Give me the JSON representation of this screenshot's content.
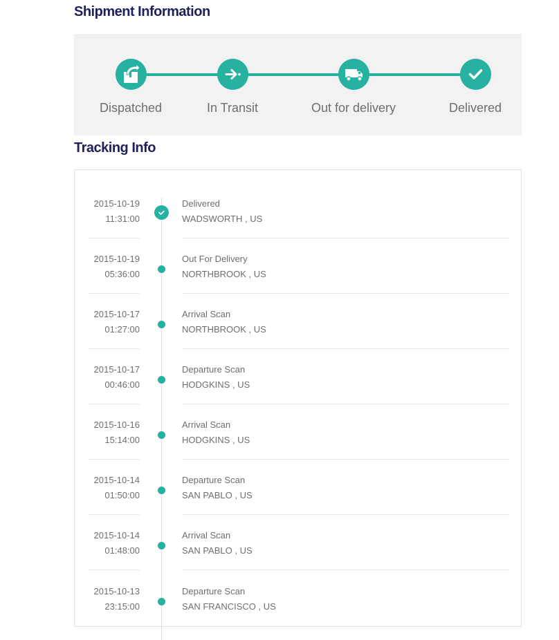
{
  "shipment": {
    "title": "Shipment Information",
    "steps": [
      {
        "label": "Dispatched",
        "icon": "dispatched-box-icon"
      },
      {
        "label": "In Transit",
        "icon": "arrow-transit-icon"
      },
      {
        "label": "Out for delivery",
        "icon": "truck-icon"
      },
      {
        "label": "Delivered",
        "icon": "checkmark-icon"
      }
    ],
    "accent_color": "#26b1a0",
    "title_color": "#1e1f5b"
  },
  "tracking": {
    "title": "Tracking Info",
    "events": [
      {
        "date": "2015-10-19",
        "time": "11:31:00",
        "status": "Delivered",
        "location": "WADSWORTH , US"
      },
      {
        "date": "2015-10-19",
        "time": "05:36:00",
        "status": "Out For Delivery",
        "location": "NORTHBROOK , US"
      },
      {
        "date": "2015-10-17",
        "time": "01:27:00",
        "status": "Arrival Scan",
        "location": "NORTHBROOK , US"
      },
      {
        "date": "2015-10-17",
        "time": "00:46:00",
        "status": "Departure Scan",
        "location": "HODGKINS , US"
      },
      {
        "date": "2015-10-16",
        "time": "15:14:00",
        "status": "Arrival Scan",
        "location": "HODGKINS , US"
      },
      {
        "date": "2015-10-14",
        "time": "01:50:00",
        "status": "Departure Scan",
        "location": "SAN PABLO , US"
      },
      {
        "date": "2015-10-14",
        "time": "01:48:00",
        "status": "Arrival Scan",
        "location": "SAN PABLO , US"
      },
      {
        "date": "2015-10-13",
        "time": "23:15:00",
        "status": "Departure Scan",
        "location": "SAN FRANCISCO , US"
      }
    ]
  }
}
